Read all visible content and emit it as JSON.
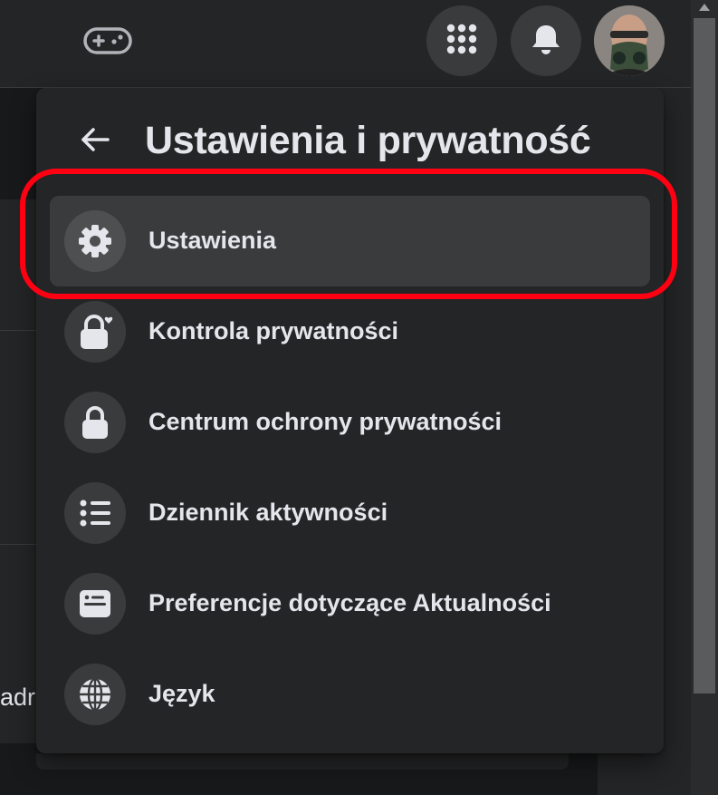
{
  "topbar": {
    "gaming_icon": "gamepad-icon",
    "menu_icon": "grid-menu-icon",
    "notifications_icon": "bell-icon",
    "avatar_alt": "profile-avatar"
  },
  "background": {
    "cut_text": "adr"
  },
  "dropdown": {
    "title": "Ustawienia i prywatność",
    "back_icon": "arrow-left-icon",
    "items": [
      {
        "label": "Ustawienia",
        "icon": "gear-icon",
        "active": true
      },
      {
        "label": "Kontrola prywatności",
        "icon": "lock-heart-icon",
        "active": false
      },
      {
        "label": "Centrum ochrony prywatności",
        "icon": "lock-icon",
        "active": false
      },
      {
        "label": "Dziennik aktywności",
        "icon": "list-icon",
        "active": false
      },
      {
        "label": "Preferencje dotyczące Aktualności",
        "icon": "feed-icon",
        "active": false
      },
      {
        "label": "Język",
        "icon": "globe-icon",
        "active": false
      }
    ]
  },
  "colors": {
    "page_bg": "#18191a",
    "surface": "#242526",
    "hover": "#3a3b3c",
    "text": "#e4e6eb",
    "highlight": "#ff0012"
  }
}
